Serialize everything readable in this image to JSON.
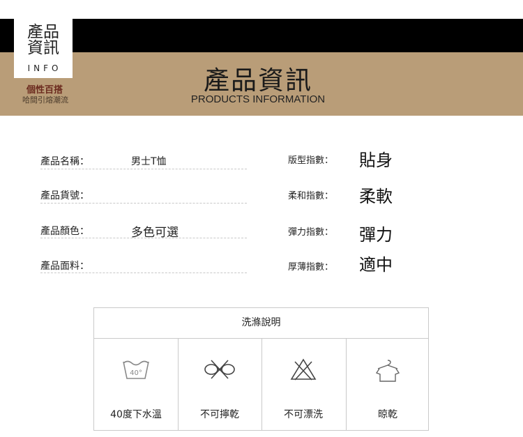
{
  "header": {
    "badge_title_line1": "產品",
    "badge_title_line2": "資訊",
    "badge_sub": "INFO",
    "tagline_main": "個性百搭",
    "tagline_sub": "哈間引熔潮流",
    "title_cn": "產品資訊",
    "title_en": "PRODUCTS INFORMATION"
  },
  "specs": [
    {
      "label": "產品名稱：",
      "value": "男士T恤"
    },
    {
      "label": "產品貨號：",
      "value": ""
    },
    {
      "label": "產品顏色：",
      "value": "多色可選"
    },
    {
      "label": "產品面料：",
      "value": ""
    }
  ],
  "indexes": [
    {
      "label": "版型指數：",
      "value": "貼身"
    },
    {
      "label": "柔和指數：",
      "value": "柔軟"
    },
    {
      "label": "彈力指數：",
      "value": "彈力"
    },
    {
      "label": "厚薄指數：",
      "value": "適中"
    }
  ],
  "care": {
    "title": "洗滌說明",
    "items": [
      {
        "label": "40度下水溫",
        "icon": "wash-40-icon",
        "icon_text": "40°"
      },
      {
        "label": "不可擰乾",
        "icon": "no-wring-icon"
      },
      {
        "label": "不可漂洗",
        "icon": "no-bleach-icon"
      },
      {
        "label": "晾乾",
        "icon": "hang-dry-icon"
      }
    ]
  }
}
